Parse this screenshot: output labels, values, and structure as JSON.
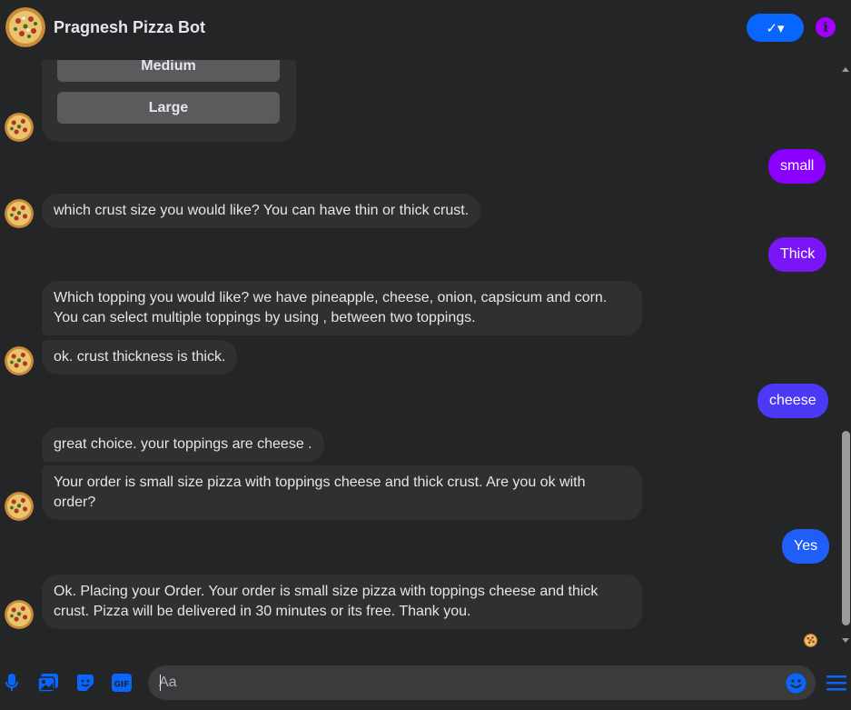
{
  "header": {
    "title": "Pragnesh Pizza Bot",
    "check_label": "✓▾",
    "info_label": "i",
    "avatar_icon": "pizza-icon",
    "accent": "#0866ff"
  },
  "quick_replies": [
    {
      "label": "Medium"
    },
    {
      "label": "Large"
    }
  ],
  "messages": [
    {
      "from": "user",
      "text": "small",
      "color": "#8a00ff"
    },
    {
      "from": "bot",
      "text": "which crust size you would like? You can have thin or thick crust."
    },
    {
      "from": "user",
      "text": "Thick",
      "color": "#7a15f5"
    },
    {
      "from": "bot",
      "text": "Which topping you would like? we have pineapple, cheese, onion, capsicum and corn. You can select multiple toppings by using , between two toppings."
    },
    {
      "from": "bot",
      "text": "ok. crust thickness is thick."
    },
    {
      "from": "user",
      "text": "cheese",
      "color": "#4b39f5"
    },
    {
      "from": "bot",
      "text": "great choice. your toppings are cheese ."
    },
    {
      "from": "bot",
      "text": "Your order is small size pizza with toppings cheese and thick crust. Are you ok with order?"
    },
    {
      "from": "user",
      "text": "Yes",
      "color": "#1f5ff8"
    },
    {
      "from": "bot",
      "text": "Ok. Placing your Order. Your order is small size pizza with toppings cheese and thick crust. Pizza will be delivered in 30 minutes or its free. Thank you."
    }
  ],
  "composer": {
    "placeholder": "Aa",
    "icons": [
      "microphone-icon",
      "image-icon",
      "sticker-icon",
      "gif-icon",
      "emoji-icon",
      "menu-icon"
    ],
    "gif_label": "GIF",
    "icon_color": "#0866ff"
  }
}
